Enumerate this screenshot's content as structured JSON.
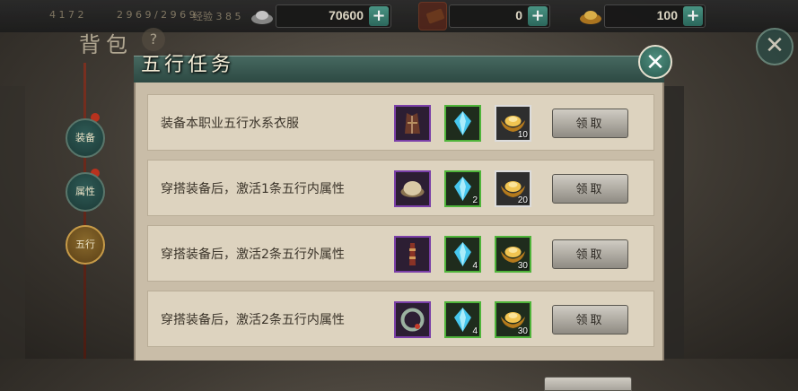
{
  "topbar": {
    "dim_stats": [
      "4 1 7 2",
      "2 9 6 9 / 2 9 6 9",
      "经验 3 8 5"
    ],
    "resources": [
      {
        "icon": "silver-ingot-icon",
        "value": "70600"
      },
      {
        "icon": "gold-bar-icon",
        "value": "0"
      },
      {
        "icon": "gold-ingot-icon",
        "value": "100"
      }
    ]
  },
  "background": {
    "bag_title": "背包",
    "help_label": "?",
    "tabs": [
      "装备",
      "属性",
      "五行"
    ],
    "close_label": "✕"
  },
  "dialog": {
    "title": "五行任务",
    "close_label": "✕",
    "claim_label": "领取",
    "quests": [
      {
        "desc": "装备本职业五行水系衣服",
        "rewards": [
          {
            "icon": "robe-icon",
            "frame": "purple",
            "count": ""
          },
          {
            "icon": "blue-crystal-icon",
            "frame": "green",
            "count": ""
          },
          {
            "icon": "gold-ingot-icon",
            "frame": "white",
            "count": "10"
          }
        ]
      },
      {
        "desc": "穿搭装备后，激活1条五行内属性",
        "rewards": [
          {
            "icon": "hat-icon",
            "frame": "purple",
            "count": ""
          },
          {
            "icon": "blue-crystal-icon",
            "frame": "green",
            "count": "2"
          },
          {
            "icon": "gold-ingot-icon",
            "frame": "white",
            "count": "20"
          }
        ]
      },
      {
        "desc": "穿搭装备后，激活2条五行外属性",
        "rewards": [
          {
            "icon": "belt-icon",
            "frame": "purple",
            "count": ""
          },
          {
            "icon": "blue-crystal-icon",
            "frame": "green",
            "count": "4"
          },
          {
            "icon": "gold-ingot-icon",
            "frame": "green",
            "count": "30"
          }
        ]
      },
      {
        "desc": "穿搭装备后，激活2条五行内属性",
        "rewards": [
          {
            "icon": "bracelet-icon",
            "frame": "purple",
            "count": ""
          },
          {
            "icon": "blue-crystal-icon",
            "frame": "green",
            "count": "4"
          },
          {
            "icon": "gold-ingot-icon",
            "frame": "green",
            "count": "30"
          }
        ]
      }
    ]
  },
  "colors": {
    "frame_purple": "#7a3fa8",
    "frame_green": "#4fb43a",
    "frame_white": "#dcdcdc",
    "dialog_header": "#2c4842",
    "panel_bg": "#c9bda8"
  }
}
